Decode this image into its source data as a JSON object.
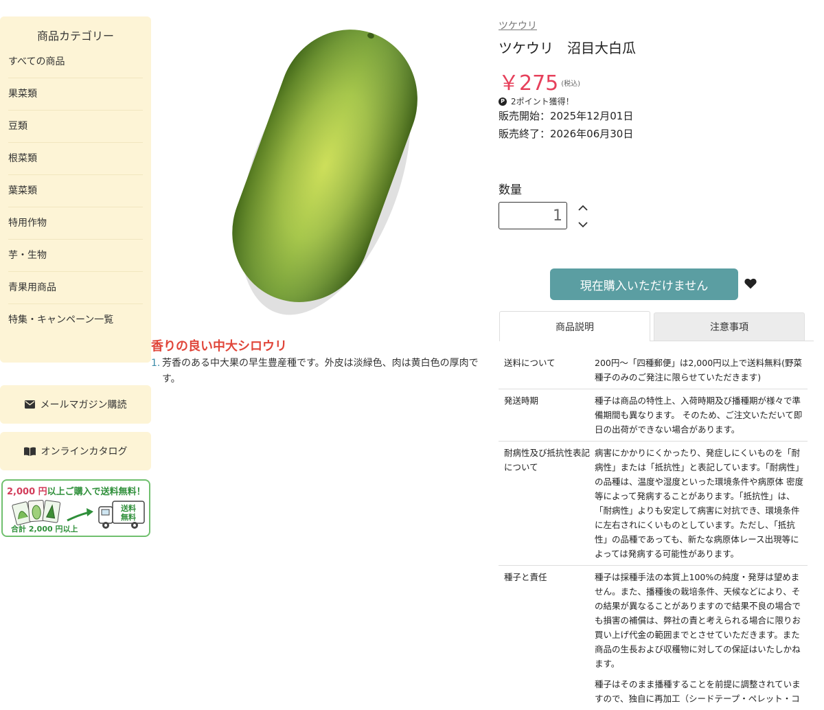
{
  "sidebar": {
    "category_title": "商品カテゴリー",
    "categories": [
      "すべての商品",
      "果菜類",
      "豆類",
      "根菜類",
      "葉菜類",
      "特用作物",
      "芋・生物",
      "青果用商品",
      "特集・キャンペーン一覧"
    ],
    "newsletter_label": "メールマガジン購読",
    "catalog_label": "オンラインカタログ",
    "shipping_banner": {
      "amount": "2,000 円",
      "headline_rest": "以上ご購入で送料無料！",
      "total_text": "合計 2,000 円以上",
      "truck_text_1": "送料",
      "truck_text_2": "無料"
    }
  },
  "product": {
    "brand": "ツケウリ",
    "name": "ツケウリ　沼目大白瓜",
    "price": "￥275",
    "tax_note": "(税込)",
    "points_icon": "P",
    "points": "2ポイント獲得！",
    "sale_start": "販売開始：2025年12月01日",
    "sale_end": "販売終了：2026年06月30日",
    "quantity_label": "数量",
    "quantity_value": "1",
    "buy_button_label": "現在購入いただけません",
    "catch_title": "香りの良い中大シロウリ",
    "descriptions": [
      {
        "num": "1.",
        "text": "芳香のある中大果の早生豊産種です。外皮は淡緑色、肉は黄白色の厚肉です。"
      }
    ]
  },
  "tabs": {
    "description": "商品説明",
    "notes": "注意事項"
  },
  "info_rows": [
    {
      "label": "送料について",
      "paragraphs": [
        "200円〜「四種郵便」は2,000円以上で送料無料(野菜種子のみのご発注に限らせていただきます)"
      ]
    },
    {
      "label": "発送時期",
      "paragraphs": [
        "種子は商品の特性上、入荷時期及び播種期が様々で準備期間も異なります。 そのため、ご注文いただいて即日の出荷ができない場合があります。"
      ]
    },
    {
      "label": "耐病性及び抵抗性表記について",
      "paragraphs": [
        "病害にかかりにくかったり、発症しにくいものを「耐病性」または「抵抗性」と表記しています。「耐病性」の品種は、温度や湿度といった環境条件や病原体 密度等によって発病することがあります。「抵抗性」は、「耐病性」よりも安定して病害に対抗でき、環境条件に左右されにくいものとしています。ただし、「抵抗性」の品種であっても、新たな病原体レース出現等によっては発病する可能性があります。"
      ]
    },
    {
      "label": "種子と責任",
      "paragraphs": [
        "種子は採種手法の本質上100%の純度・発芽は望めません。また、播種後の栽培条件、天候などにより、その結果が異なることがありますので結果不良の場合でも損害の補償は、弊社の責と考えられる場合に限りお買い上げ代金の範囲までとさせていただきます。また商品の生長および収穫物に対しての保証はいたしかねます。",
        "種子はそのまま播種することを前提に調整されていますので、独自に再加工（シードテープ・ペレット・コ"
      ]
    }
  ],
  "icons": {
    "mail": "envelope-icon",
    "catalog": "open-book-icon",
    "favorite": "heart-icon",
    "up": "chevron-up-icon",
    "down": "chevron-down-icon"
  },
  "colors": {
    "sidebar_bg": "#fdf4d6",
    "price": "#e6405b",
    "catch_title": "#e0463a",
    "buy_button": "#5b9ea2",
    "banner_green": "#2f8f3a"
  }
}
